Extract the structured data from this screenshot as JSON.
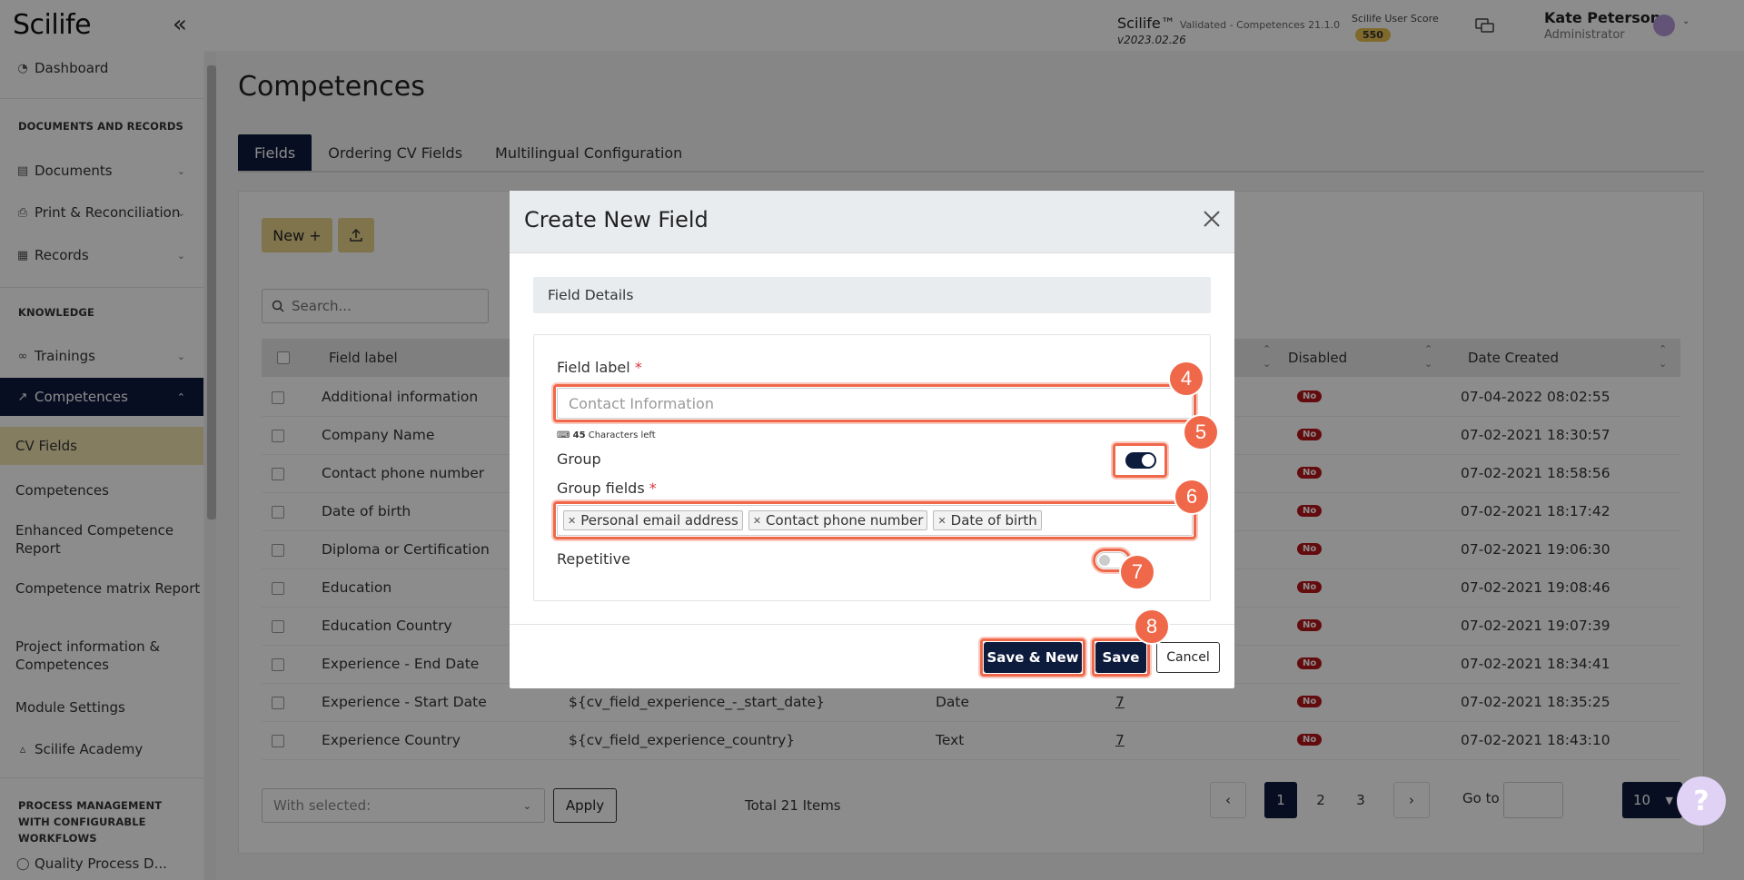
{
  "header": {
    "logo": "Scilife",
    "collapse_icon": "double-chevron-left-icon",
    "app_name": "Scilife™",
    "validated_text": "Validated - Competences 21.1.0",
    "version": "v2023.02.26",
    "score_label": "Scilife User Score",
    "score_value": "550",
    "chat_icon": "chat-icon",
    "user_name": "Kate Peterson",
    "user_role": "Administrator",
    "user_caret": "chevron-down-icon"
  },
  "sidebar": {
    "dashboard": "Dashboard",
    "section_docs": "DOCUMENTS AND RECORDS",
    "documents": "Documents",
    "print_reconciliation": "Print & Reconciliation",
    "records": "Records",
    "section_knowledge": "KNOWLEDGE",
    "trainings": "Trainings",
    "competences": "Competences",
    "sub_items": [
      "CV Fields",
      "Competences",
      "Enhanced Competence Report",
      "Competence matrix Report",
      "Project information & Competences",
      "Module Settings"
    ],
    "academy": "Scilife Academy",
    "section_process": "PROCESS MANAGEMENT WITH CONFIGURABLE WORKFLOWS",
    "quality_process": "Quality Process D..."
  },
  "main": {
    "title": "Competences",
    "tabs": [
      "Fields",
      "Ordering CV Fields",
      "Multilingual Configuration"
    ],
    "new_button": "New +",
    "upload_icon": "upload-icon",
    "search_placeholder": "Search...",
    "columns": [
      "Field label",
      "Disabled",
      "Date Created"
    ],
    "rows": [
      {
        "label": "Additional information",
        "key": "",
        "type": "",
        "count": "",
        "disabled": "No",
        "date": "07-04-2022 08:02:55"
      },
      {
        "label": "Company Name",
        "key": "",
        "type": "",
        "count": "",
        "disabled": "No",
        "date": "07-02-2021 18:30:57"
      },
      {
        "label": "Contact phone number",
        "key": "",
        "type": "",
        "count": "",
        "disabled": "No",
        "date": "07-02-2021 18:58:56"
      },
      {
        "label": "Date of birth",
        "key": "",
        "type": "",
        "count": "",
        "disabled": "No",
        "date": "07-02-2021 18:17:42"
      },
      {
        "label": "Diploma or Certification",
        "key": "",
        "type": "",
        "count": "",
        "disabled": "No",
        "date": "07-02-2021 19:06:30"
      },
      {
        "label": "Education",
        "key": "",
        "type": "",
        "count": "",
        "disabled": "No",
        "date": "07-02-2021 19:08:46"
      },
      {
        "label": "Education Country",
        "key": "",
        "type": "",
        "count": "",
        "disabled": "No",
        "date": "07-02-2021 19:07:39"
      },
      {
        "label": "Experience - End Date",
        "key": "",
        "type": "",
        "count": "",
        "disabled": "No",
        "date": "07-02-2021 18:34:41"
      },
      {
        "label": "Experience - Start Date",
        "key": "${cv_field_experience_-_start_date}",
        "type": "Date",
        "count": "7",
        "disabled": "No",
        "date": "07-02-2021 18:35:25"
      },
      {
        "label": "Experience Country",
        "key": "${cv_field_experience_country}",
        "type": "Text",
        "count": "7",
        "disabled": "No",
        "date": "07-02-2021 18:43:10"
      }
    ],
    "with_selected": "With selected:",
    "apply": "Apply",
    "total": "Total 21 Items",
    "pages": [
      "1",
      "2",
      "3"
    ],
    "goto": "Go to",
    "page_size": "10",
    "help": "?"
  },
  "modal": {
    "title": "Create New Field",
    "section_header": "Field Details",
    "field_label": "Field label",
    "required_mark": "*",
    "field_label_placeholder": "Contact Information",
    "chars_count": "45",
    "chars_text": "Characters left",
    "group_label": "Group",
    "group_on": true,
    "group_fields_label": "Group fields",
    "group_fields": [
      "Personal email address",
      "Contact phone number",
      "Date of birth"
    ],
    "repetitive_label": "Repetitive",
    "repetitive_on": false,
    "save_new": "Save & New",
    "save": "Save",
    "cancel": "Cancel",
    "steps": [
      "4",
      "5",
      "6",
      "7",
      "8"
    ],
    "highlight_color": "#f0684a"
  }
}
